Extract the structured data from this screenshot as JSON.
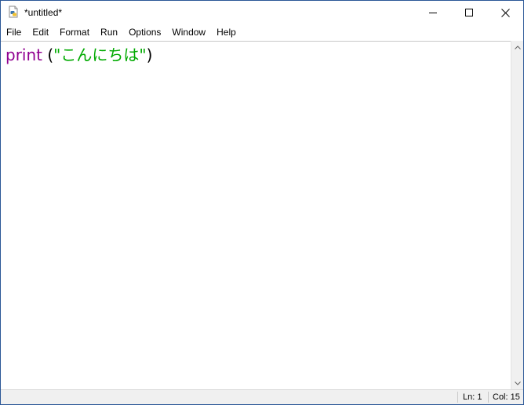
{
  "window": {
    "title": "*untitled*"
  },
  "menu": {
    "items": [
      "File",
      "Edit",
      "Format",
      "Run",
      "Options",
      "Window",
      "Help"
    ]
  },
  "editor": {
    "tokens": {
      "builtin": "print",
      "space_paren": " (",
      "string": "\"こんにちは\"",
      "close_paren": ")"
    },
    "colors": {
      "builtin": "#900090",
      "string": "#00aa00",
      "plain": "#000000"
    }
  },
  "statusbar": {
    "line": "Ln: 1",
    "column": "Col: 15"
  },
  "icons": {
    "app": "python-file-icon",
    "minimize": "minimize-icon",
    "maximize": "maximize-icon",
    "close": "close-icon",
    "scroll_up": "chevron-up-icon",
    "scroll_down": "chevron-down-icon"
  }
}
